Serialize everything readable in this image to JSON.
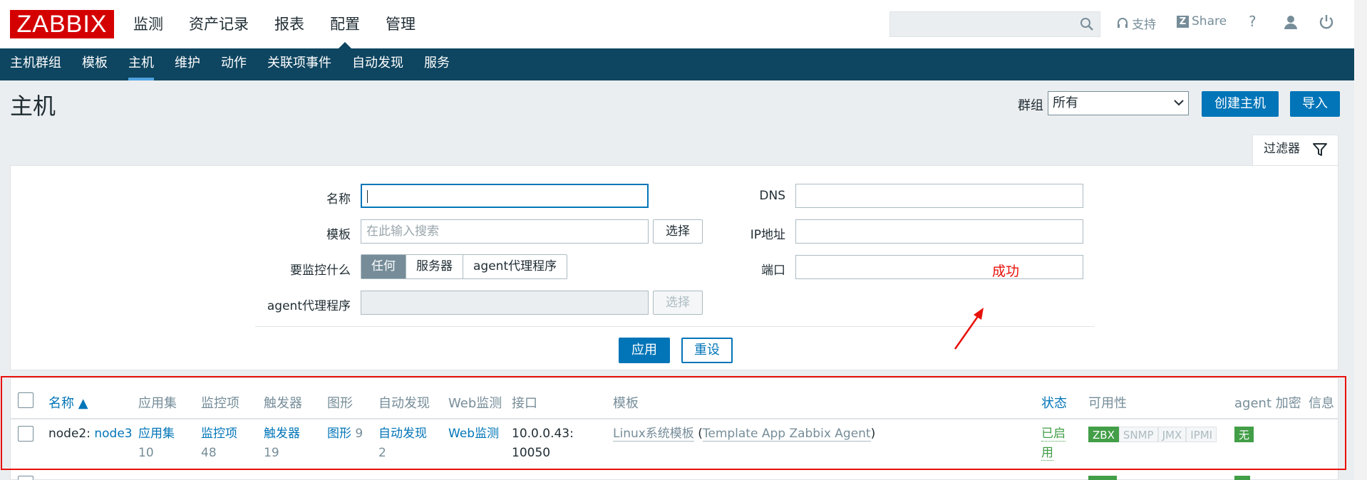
{
  "app": {
    "logo": "ZABBIX"
  },
  "topnav": [
    "监测",
    "资产记录",
    "报表",
    "配置",
    "管理"
  ],
  "header_links": {
    "support": "支持",
    "share": "Share",
    "help": "?"
  },
  "subnav": [
    "主机群组",
    "模板",
    "主机",
    "维护",
    "动作",
    "关联项事件",
    "自动发现",
    "服务"
  ],
  "page": {
    "title": "主机",
    "group_label": "群组",
    "group_value": "所有",
    "create_button": "创建主机",
    "import_button": "导入"
  },
  "filter": {
    "tab_label": "过滤器",
    "name_label": "名称",
    "name_value": "",
    "template_label": "模板",
    "template_placeholder": "在此输入搜索",
    "select_label": "选择",
    "monitored_by_label": "要监控什么",
    "monitored_by_options": [
      "任何",
      "服务器",
      "agent代理程序"
    ],
    "monitored_by_selected": "任何",
    "proxy_label": "agent代理程序",
    "proxy_select_label": "选择",
    "dns_label": "DNS",
    "ip_label": "IP地址",
    "port_label": "端口",
    "apply_button": "应用",
    "reset_button": "重设"
  },
  "annotation": {
    "text": "成功",
    "color": "#e8110b"
  },
  "table": {
    "columns": [
      "名称 ▲",
      "应用集",
      "监控项",
      "触发器",
      "图形",
      "自动发现",
      "Web监测",
      "接口",
      "模板",
      "状态",
      "可用性",
      "agent 加密",
      "信息"
    ],
    "rows": [
      {
        "name_prefix": "node2: ",
        "name_link": "node3",
        "applications_label": "应用集",
        "applications_count": "10",
        "items_label": "监控项",
        "items_count": "48",
        "triggers_label": "触发器",
        "triggers_count": "19",
        "graphs_label": "图形",
        "graphs_count": "9",
        "discovery_label": "自动发现",
        "discovery_count": "2",
        "web_label": "Web监测",
        "interface": "10.0.0.43: 10050",
        "template": "Linux系统模板",
        "template_parent": "Template App Zabbix Agent",
        "status": "已启用",
        "availability": [
          "ZBX",
          "SNMP",
          "JMX",
          "IPMI"
        ],
        "encryption": "无"
      }
    ]
  },
  "colors": {
    "brand": "#d40000",
    "nav": "#0e4560",
    "primary": "#0275b8",
    "ok": "#429e47"
  }
}
